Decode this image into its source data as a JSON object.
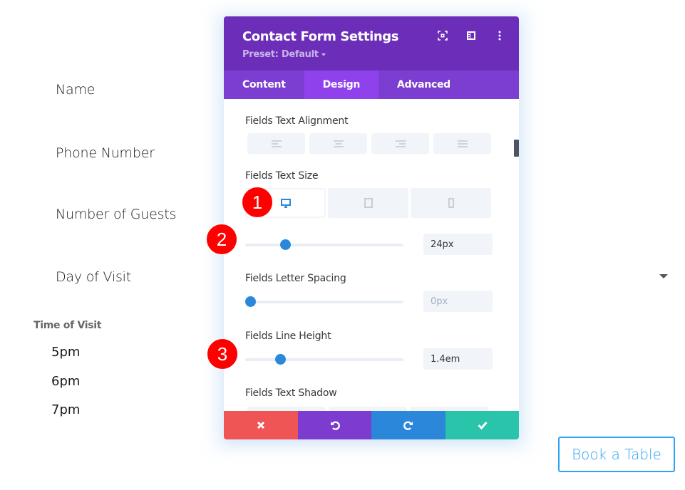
{
  "form": {
    "fields": [
      "Name",
      "Phone Number",
      "Number of Guests",
      "Day of Visit"
    ],
    "time_title": "Time of Visit",
    "time_options": [
      "5pm",
      "6pm",
      "7pm"
    ],
    "submit_label": "Book a Table"
  },
  "panel": {
    "title": "Contact Form Settings",
    "preset": "Preset: Default",
    "header_icons": [
      "expand-icon",
      "split-view-icon",
      "more-options-icon"
    ],
    "tabs": [
      {
        "label": "Content",
        "active": false
      },
      {
        "label": "Design",
        "active": true
      },
      {
        "label": "Advanced",
        "active": false
      }
    ],
    "settings": {
      "alignment_label": "Fields Text Alignment",
      "alignment_options": [
        "left",
        "center",
        "right",
        "justify"
      ],
      "text_size_label": "Fields Text Size",
      "devices": [
        "desktop",
        "tablet",
        "phone"
      ],
      "active_device": "desktop",
      "text_size_value": "24px",
      "text_size_fraction": 0.25,
      "letter_spacing_label": "Fields Letter Spacing",
      "letter_spacing_value": "0px",
      "letter_spacing_fraction": 0.03,
      "line_height_label": "Fields Line Height",
      "line_height_value": "1.4em",
      "line_height_fraction": 0.22,
      "text_shadow_label": "Fields Text Shadow"
    },
    "footer": {
      "cancel": "cancel",
      "undo": "undo",
      "redo": "redo",
      "save": "save"
    }
  },
  "annotations": [
    "1",
    "2",
    "3"
  ],
  "colors": {
    "header": "#6c2eb9",
    "tabs": "#7b3ed0",
    "tab_active": "#8f42ec",
    "accent": "#2b87da",
    "cancel": "#ef5555",
    "undo": "#7e3bd0",
    "redo": "#2b87da",
    "save": "#29c4a9",
    "badge": "#ff0000",
    "button_border": "#2ea3f2"
  }
}
